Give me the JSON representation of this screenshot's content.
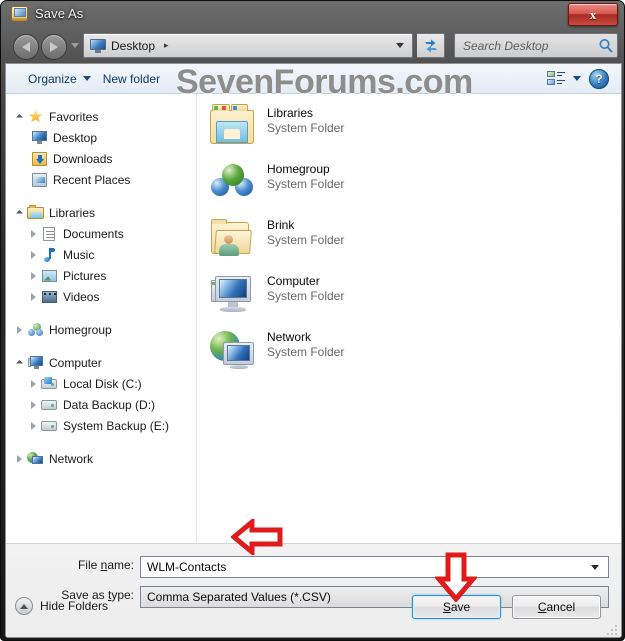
{
  "window": {
    "title": "Save As",
    "title_icon": "save-as-icon",
    "close_label": "x"
  },
  "navbar": {
    "back_icon": "back-arrow-icon",
    "forward_icon": "forward-arrow-icon",
    "history_icon": "chevron-down-icon",
    "address_icon": "desktop-monitor-icon",
    "address_text": "Desktop",
    "address_separator": "▸",
    "address_dropdown_icon": "chevron-down-icon",
    "refresh_icon": "refresh-icon",
    "search_placeholder": "Search Desktop",
    "search_value": "",
    "search_icon": "magnifier-icon"
  },
  "toolbar": {
    "organize_label": "Organize",
    "organize_caret_icon": "caret-down-icon",
    "new_folder_label": "New folder",
    "view_icon": "view-options-icon",
    "view_caret_icon": "caret-down-icon",
    "help_icon": "help-question-icon",
    "help_label": "?"
  },
  "watermark": {
    "text": "SevenForums.com",
    "color": "#8d8d8d"
  },
  "sidebar": {
    "groups": [
      {
        "header": {
          "label": "Favorites",
          "icon": "star-icon",
          "state": "expanded"
        },
        "items": [
          {
            "label": "Desktop",
            "icon": "desktop-monitor-icon",
            "state": "leaf"
          },
          {
            "label": "Downloads",
            "icon": "downloads-folder-icon",
            "state": "leaf"
          },
          {
            "label": "Recent Places",
            "icon": "recent-places-icon",
            "state": "leaf"
          }
        ]
      },
      {
        "header": {
          "label": "Libraries",
          "icon": "libraries-icon",
          "state": "expanded"
        },
        "items": [
          {
            "label": "Documents",
            "icon": "documents-icon",
            "state": "collapsed"
          },
          {
            "label": "Music",
            "icon": "music-note-icon",
            "state": "collapsed"
          },
          {
            "label": "Pictures",
            "icon": "pictures-icon",
            "state": "collapsed"
          },
          {
            "label": "Videos",
            "icon": "videos-icon",
            "state": "collapsed"
          }
        ]
      },
      {
        "header": {
          "label": "Homegroup",
          "icon": "homegroup-icon",
          "state": "collapsed"
        },
        "items": []
      },
      {
        "header": {
          "label": "Computer",
          "icon": "computer-icon",
          "state": "expanded"
        },
        "items": [
          {
            "label": "Local Disk (C:)",
            "icon": "system-drive-icon",
            "state": "collapsed"
          },
          {
            "label": "Data Backup (D:)",
            "icon": "hard-drive-icon",
            "state": "collapsed"
          },
          {
            "label": "System Backup (E:)",
            "icon": "hard-drive-icon",
            "state": "collapsed"
          }
        ]
      },
      {
        "header": {
          "label": "Network",
          "icon": "network-icon",
          "state": "collapsed"
        },
        "items": []
      }
    ]
  },
  "file_list": {
    "items": [
      {
        "name": "Libraries",
        "type": "System Folder",
        "icon": "libraries-folder-icon"
      },
      {
        "name": "Homegroup",
        "type": "System Folder",
        "icon": "homegroup-spheres-icon"
      },
      {
        "name": "Brink",
        "type": "System Folder",
        "icon": "user-folder-icon"
      },
      {
        "name": "Computer",
        "type": "System Folder",
        "icon": "computer-icon"
      },
      {
        "name": "Network",
        "type": "System Folder",
        "icon": "network-globe-icon"
      }
    ]
  },
  "form": {
    "file_name_label": "File name:",
    "file_name_label_accel": "n",
    "file_name_value": "WLM-Contacts",
    "file_name_dropdown_icon": "caret-down-icon",
    "save_type_label": "Save as type:",
    "save_type_label_accel": "t",
    "save_type_value": "Comma Separated Values (*.CSV)",
    "save_type_dropdown_icon": "caret-down-icon"
  },
  "footer": {
    "hide_folders_label": "Hide Folders",
    "hide_folders_icon": "chevron-up-circle-icon",
    "save_label": "Save",
    "save_accel": "S",
    "cancel_label": "Cancel",
    "cancel_accel": "C",
    "resize_grip_icon": "resize-grip-icon"
  },
  "annotations": {
    "color": "#e01b1b",
    "items": [
      {
        "icon": "red-left-arrow-annotation",
        "points_at": "file-name-input"
      },
      {
        "icon": "red-down-arrow-annotation",
        "points_at": "save-button"
      }
    ]
  }
}
